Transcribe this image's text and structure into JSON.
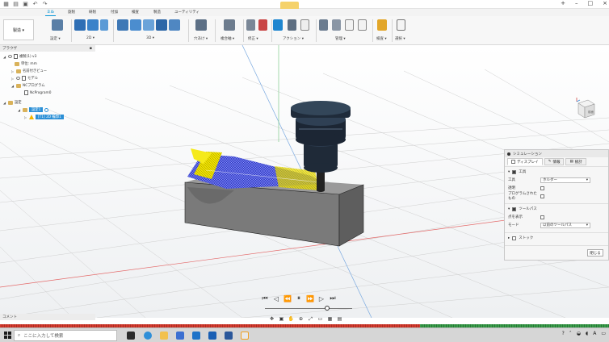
{
  "ribbon": {
    "tabs": [
      "ミル",
      "旋削",
      "研削",
      "付加",
      "検査",
      "製造",
      "ユーティリティ"
    ],
    "active_tab": "ミル",
    "workspace_label": "製造 ▾",
    "groups": [
      {
        "label": "設定 ▾"
      },
      {
        "label": "2D ▾"
      },
      {
        "label": "3D ▾"
      },
      {
        "label": "穴あけ ▾"
      },
      {
        "label": "複合軸 ▾"
      },
      {
        "label": "修正 ▾"
      },
      {
        "label": "アクション ▾"
      },
      {
        "label": "管理 ▾"
      },
      {
        "label": "検査 ▾"
      },
      {
        "label": "選択 ▾"
      }
    ],
    "accent": "#0696d7"
  },
  "browser": {
    "title": "ブラウザ",
    "items": [
      {
        "label": "複製(1) v3"
      },
      {
        "label": "単位: mm"
      },
      {
        "label": "名前付きビュー"
      },
      {
        "label": "モデル"
      },
      {
        "label": "NCプログラム"
      },
      {
        "label": "NcProgram0"
      },
      {
        "label": "設定"
      },
      {
        "label": "設定1"
      },
      {
        "label": "[T1] 2D 輪郭1"
      }
    ]
  },
  "viewcube": {
    "label": "前面"
  },
  "simulation": {
    "title": "シミュレーション",
    "tabs": [
      "ディスプレイ",
      "情報",
      "統計"
    ],
    "active_tab": "ディスプレイ",
    "tool_section": "工具",
    "tool_label": "工具",
    "tool_value": "ホルダー",
    "transparent_label": "透明",
    "colorize_label": "プログラムされたもの",
    "toolpath_section": "ツールパス",
    "show_points_label": "点を表示",
    "mode_label": "モード",
    "mode_value": "以前のツールパス",
    "stock_section": "ストック",
    "close_label": "閉じる"
  },
  "comments": {
    "label": "コメント"
  },
  "taskbar": {
    "search_placeholder": "ここに入力して検索",
    "ime": "A"
  }
}
